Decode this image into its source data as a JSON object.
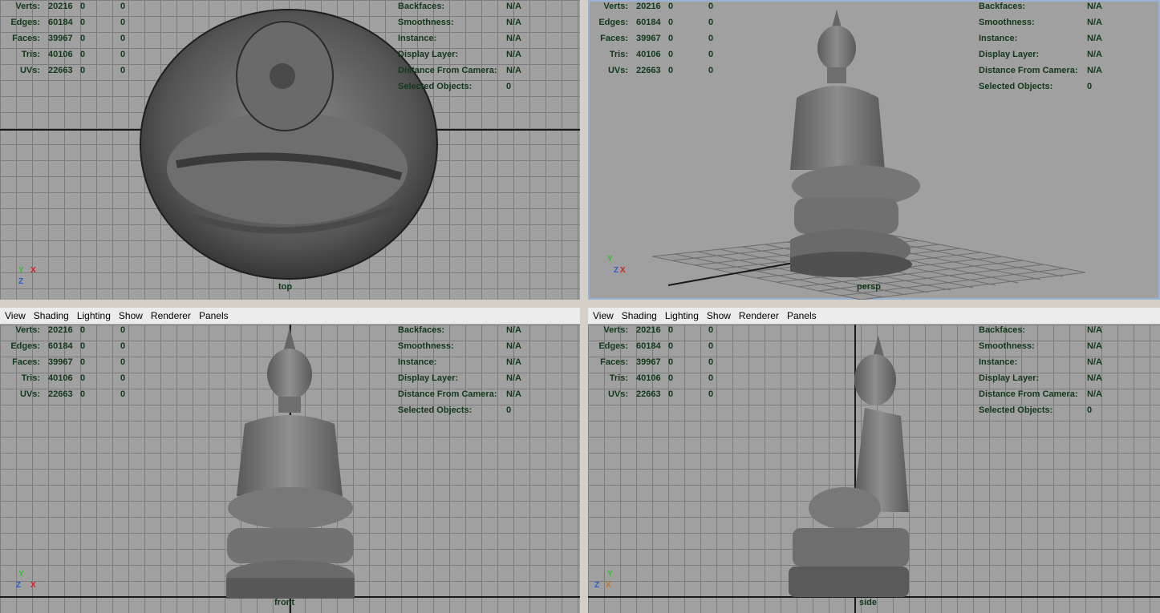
{
  "menu": [
    "View",
    "Shading",
    "Lighting",
    "Show",
    "Renderer",
    "Panels"
  ],
  "stats": [
    {
      "label": "Verts:",
      "v1": "20216",
      "v2": "0",
      "v3": "0"
    },
    {
      "label": "Edges:",
      "v1": "60184",
      "v2": "0",
      "v3": "0"
    },
    {
      "label": "Faces:",
      "v1": "39967",
      "v2": "0",
      "v3": "0"
    },
    {
      "label": "Tris:",
      "v1": "40106",
      "v2": "0",
      "v3": "0"
    },
    {
      "label": "UVs:",
      "v1": "22663",
      "v2": "0",
      "v3": "0"
    }
  ],
  "info": [
    {
      "label": "Backfaces:",
      "value": "N/A"
    },
    {
      "label": "Smoothness:",
      "value": "N/A"
    },
    {
      "label": "Instance:",
      "value": "N/A"
    },
    {
      "label": "Display Layer:",
      "value": "N/A"
    },
    {
      "label": "Distance From Camera:",
      "value": "N/A"
    },
    {
      "label": "Selected Objects:",
      "value": "0"
    }
  ],
  "panels": {
    "top": {
      "camera": "top",
      "axes": {
        "a": "Y",
        "b": "X",
        "c": "Z"
      }
    },
    "persp": {
      "camera": "persp",
      "axes": {
        "a": "Y",
        "b": "Z",
        "c": "X"
      }
    },
    "front": {
      "camera": "front",
      "axes": {
        "a": "Y",
        "b": "X",
        "c": "Z"
      }
    },
    "side": {
      "camera": "side",
      "axes": {
        "a": "Y",
        "b": "Z",
        "c": "X"
      }
    }
  },
  "colors": {
    "viewport_bg": "#a0a0a0",
    "grid": "#7c7c7c",
    "hud_text": "#12381a",
    "active_border": "#9ab3d5"
  }
}
